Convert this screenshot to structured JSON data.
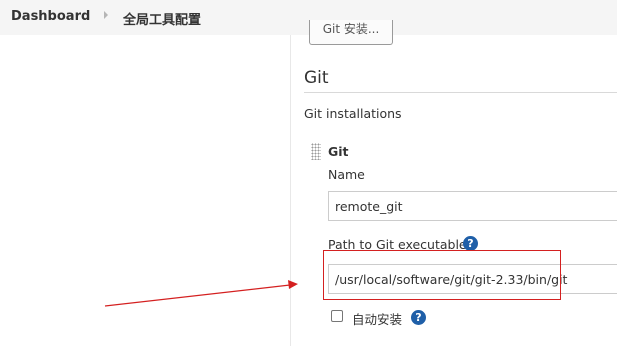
{
  "breadcrumb": {
    "dashboard_label": "Dashboard",
    "current_page_label": "全局工具配置"
  },
  "top_button": {
    "label": "Git 安装..."
  },
  "git_section": {
    "title": "Git",
    "installations_label": "Git installations",
    "installation": {
      "block_title": "Git",
      "name_label": "Name",
      "name_value": "remote_git",
      "path_label": "Path to Git executable",
      "path_value": "/usr/local/software/git/git-2.33/bin/git",
      "auto_install_label": "自动安装",
      "auto_install_checked": false
    }
  },
  "help_icon_glyph": "?",
  "icons": {
    "breadcrumb_separator": "chevron-right-icon",
    "help": "help-icon",
    "drag": "drag-handle-icon"
  },
  "colors": {
    "annotation": "#d42020",
    "help_icon": "#1f5fa8",
    "breadcrumb_bg": "#f5f5f5"
  }
}
